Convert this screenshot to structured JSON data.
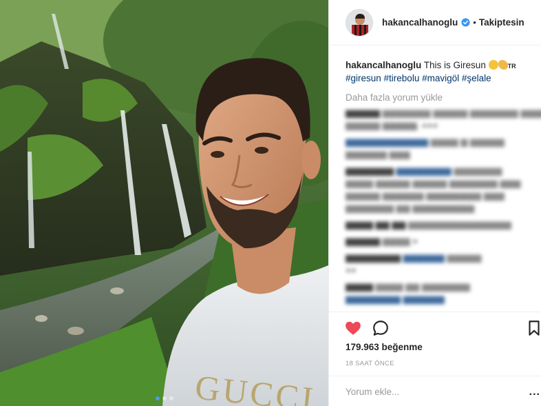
{
  "header": {
    "username": "hakancalhanoglu",
    "separator": "•",
    "follow_status": "Takiptesin"
  },
  "caption": {
    "username": "hakancalhanoglu",
    "text": "This is Giresun",
    "flag": "TR",
    "hashtags": "#giresun #tirebolu #mavigöl #şelale"
  },
  "comments": {
    "load_more": "Daha fazla yorum yükle"
  },
  "actions": {
    "icons": [
      "heart-icon",
      "comment-icon",
      "bookmark-icon"
    ],
    "like_color": "#ed4956"
  },
  "likes": "179.963 beğenme",
  "timestamp": "18 SAAT ÖNCE",
  "add_comment": {
    "placeholder": "Yorum ekle...",
    "more": "..."
  },
  "carousel": {
    "count": 3,
    "active_index": 0
  },
  "colors": {
    "link": "#003569",
    "muted": "#999999",
    "verified": "#3897f0"
  }
}
